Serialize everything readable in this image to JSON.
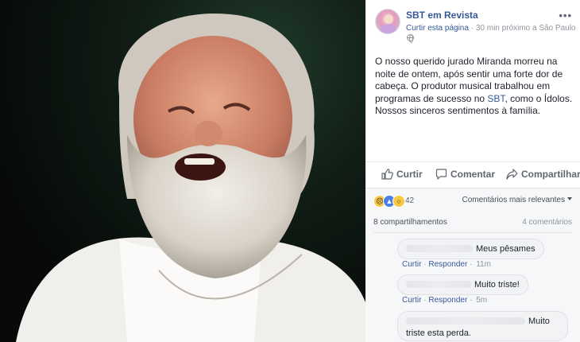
{
  "post": {
    "page_name": "SBT em Revista",
    "like_page": "Curtir esta página",
    "meta_sep": "·",
    "meta_time": "30 min",
    "meta_location": "próximo a São Paulo",
    "more": "•••",
    "body_part1": "O nosso querido jurado Miranda morreu na noite de ontem, após sentir uma forte dor de cabeça. O produtor musical trabalhou em programas de sucesso no ",
    "body_link": "SBT",
    "body_part2": ", como o Ídolos. Nossos sinceros sentimentos à família."
  },
  "actions": {
    "like": "Curtir",
    "comment": "Comentar",
    "share": "Compartilhar"
  },
  "stats": {
    "reaction_count": "42",
    "sort_label": "Comentários mais relevantes",
    "shares": "8 compartilhamentos",
    "comments": "4 comentários"
  },
  "comments": [
    {
      "text": "Meus pêsames",
      "like": "Curtir",
      "sep": "·",
      "reply": "Responder",
      "time": "11m"
    },
    {
      "text": "Muito triste!",
      "like": "Curtir",
      "sep": "·",
      "reply": "Responder",
      "time": "5m"
    },
    {
      "text": "Muito",
      "text2": "triste esta perda."
    }
  ],
  "colors": {
    "link": "#365899",
    "secondary": "#90949c",
    "like_reaction": "#4a7ee8",
    "sad_reaction": "#f7c843"
  },
  "icons": [
    "thumbs-up-icon",
    "comment-bubble-icon",
    "share-arrow-icon",
    "globe-icon",
    "more-icon",
    "sad-reaction-icon",
    "like-reaction-icon",
    "wow-reaction-icon"
  ]
}
